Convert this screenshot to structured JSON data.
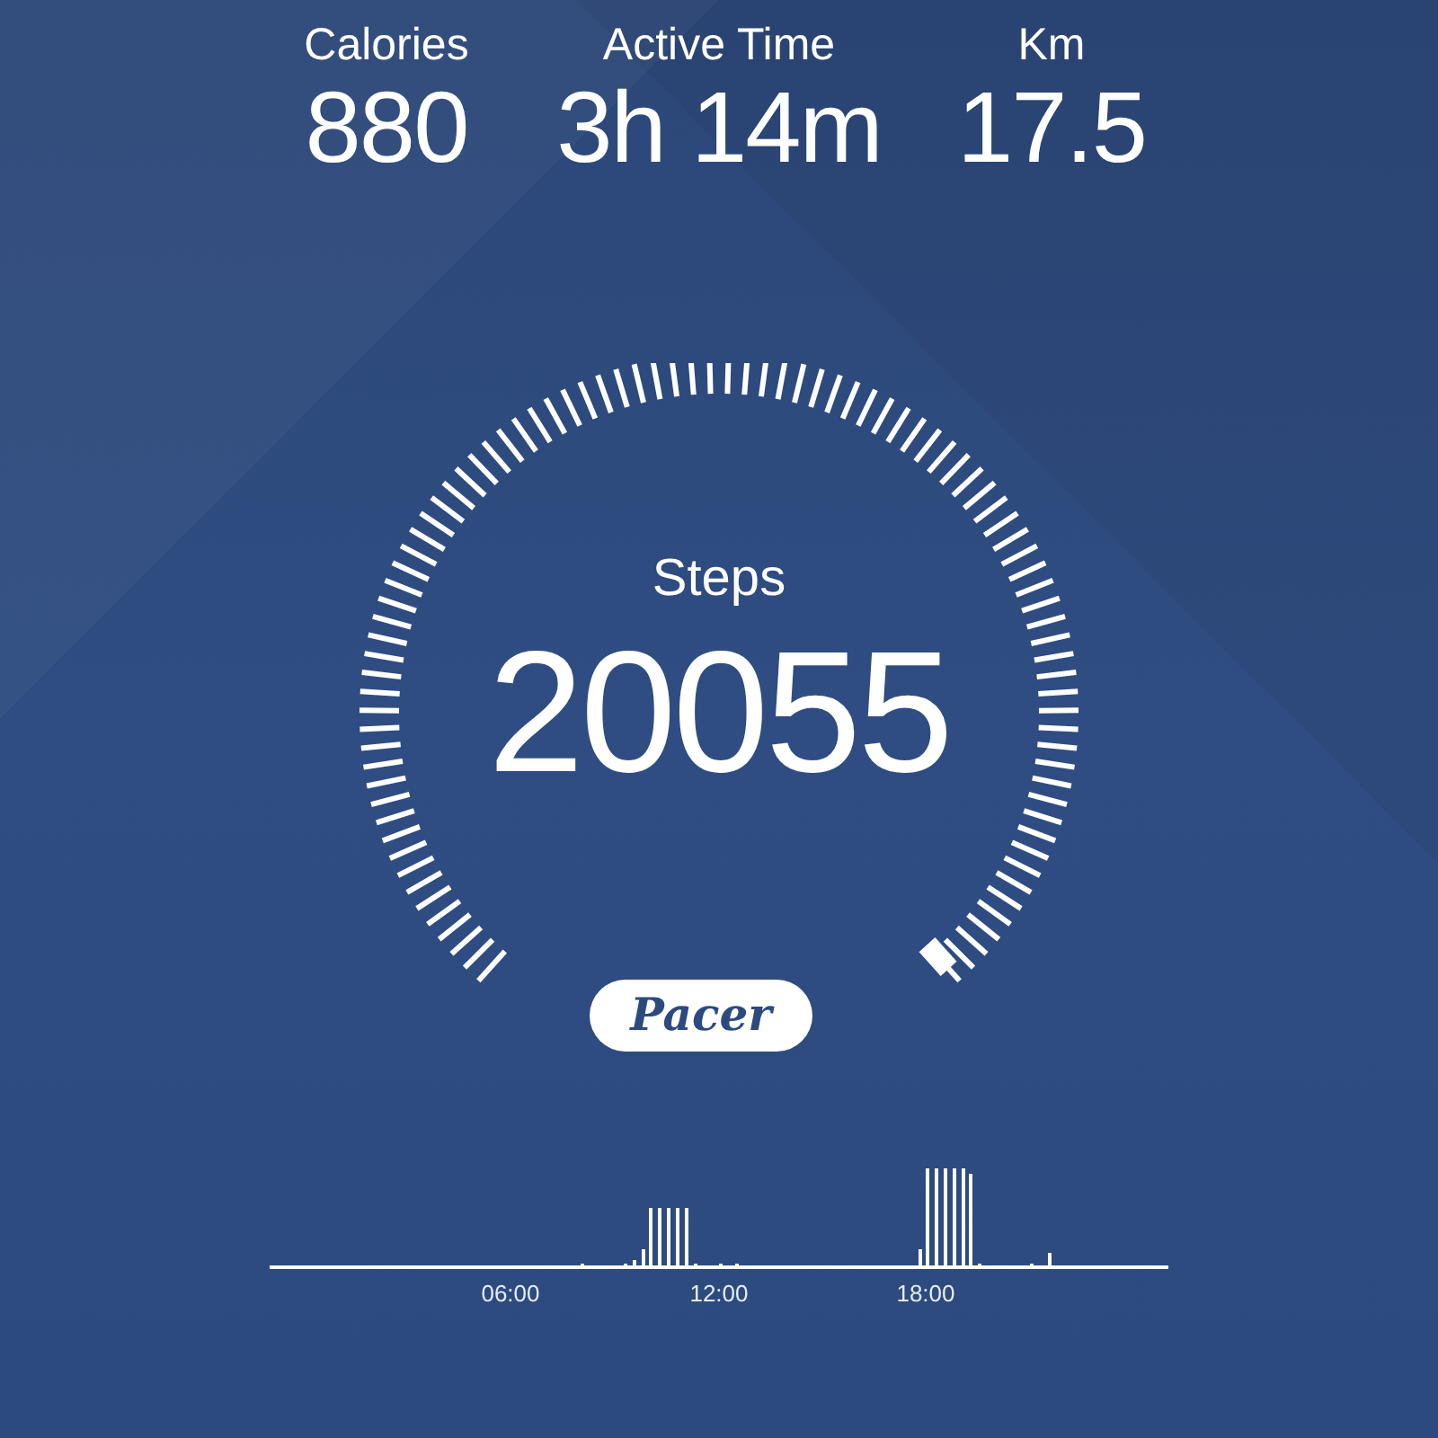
{
  "stats": [
    {
      "label": "Calories",
      "value": "880"
    },
    {
      "label": "Active Time",
      "value": "3h 14m"
    },
    {
      "label": "Km",
      "value": "17.5"
    }
  ],
  "gauge": {
    "label": "Steps",
    "value": "20055"
  },
  "brand": "Pacer",
  "activity": {
    "kind": "picture",
    "time_labels": [
      "06:00",
      "12:00",
      "18:00"
    ]
  }
}
